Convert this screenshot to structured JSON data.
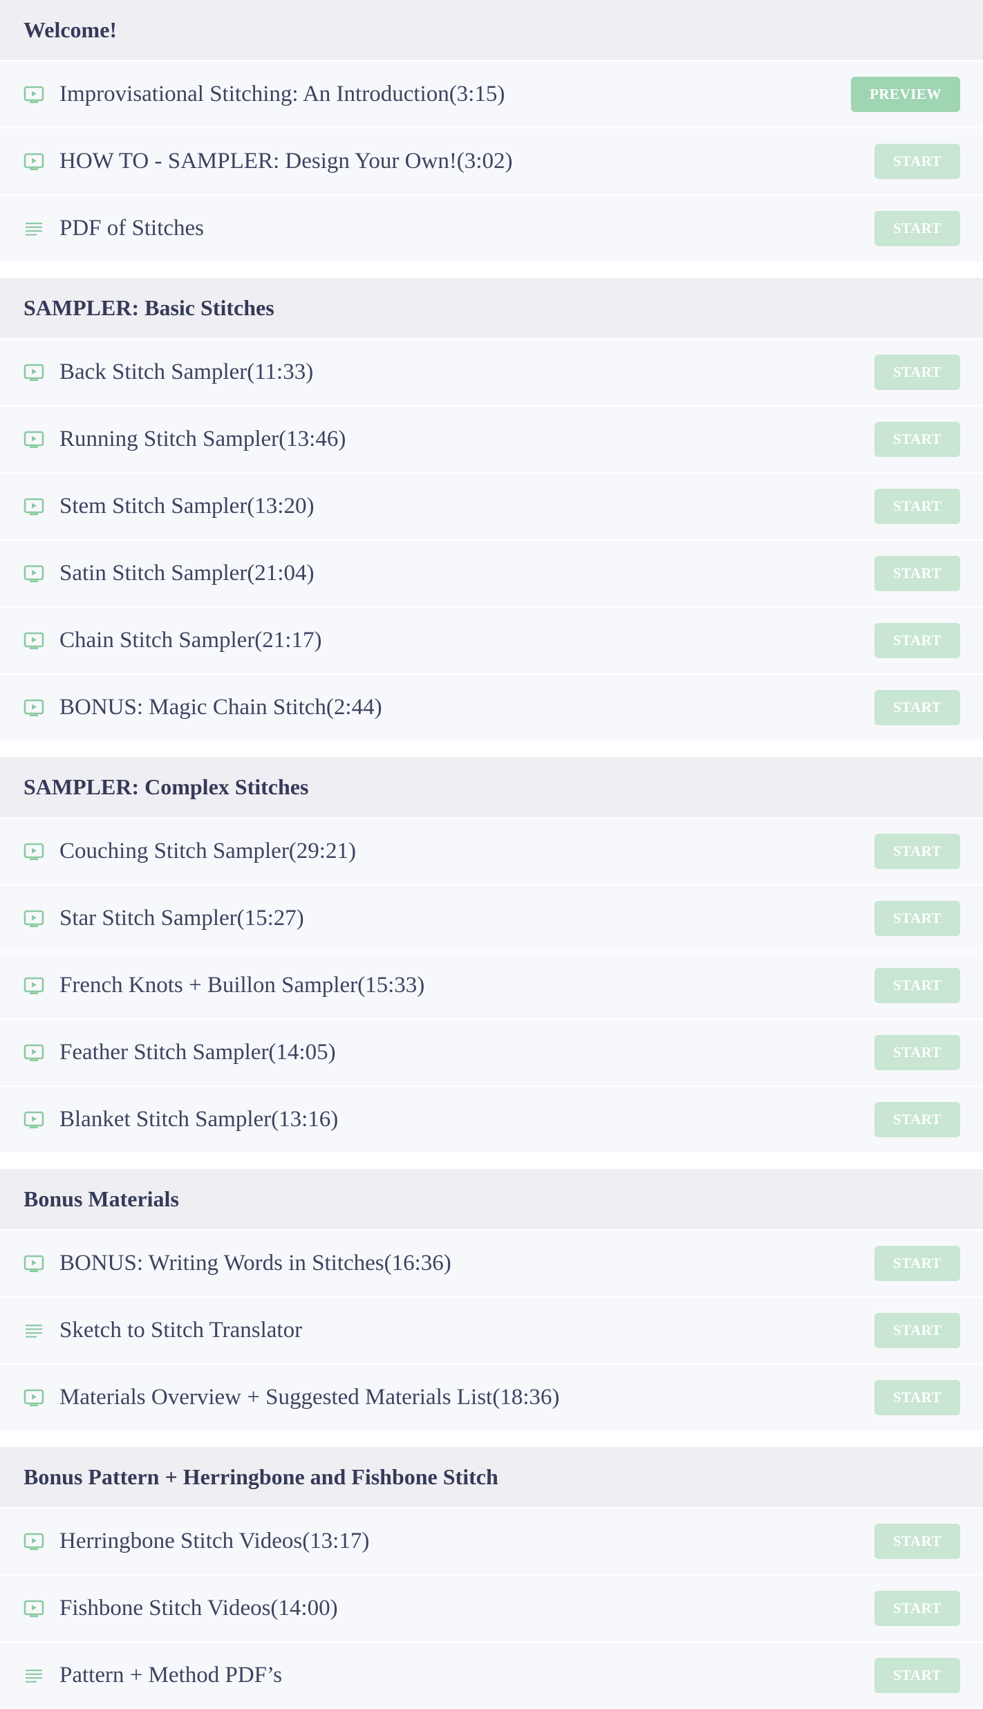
{
  "colors": {
    "accent": "#8ccaa1",
    "start_button": "#c8e6d2",
    "preview_button": "#9fd5b2",
    "section_bg": "#efeff3",
    "row_bg": "#f7f8fc",
    "heading_text": "#363a59",
    "body_text": "#3f425e"
  },
  "sections": [
    {
      "title": "Welcome!",
      "lectures": [
        {
          "icon": "video-icon",
          "title": "Improvisational Stitching: An Introduction(3:15)",
          "action": "PREVIEW"
        },
        {
          "icon": "video-icon",
          "title": "HOW TO - SAMPLER: Design Your Own!(3:02)",
          "action": "START"
        },
        {
          "icon": "text-icon",
          "title": "PDF of Stitches",
          "action": "START"
        }
      ]
    },
    {
      "title": "SAMPLER: Basic Stitches",
      "lectures": [
        {
          "icon": "video-icon",
          "title": "Back Stitch Sampler(11:33)",
          "action": "START"
        },
        {
          "icon": "video-icon",
          "title": "Running Stitch Sampler(13:46)",
          "action": "START"
        },
        {
          "icon": "video-icon",
          "title": "Stem Stitch Sampler(13:20)",
          "action": "START"
        },
        {
          "icon": "video-icon",
          "title": "Satin Stitch Sampler(21:04)",
          "action": "START"
        },
        {
          "icon": "video-icon",
          "title": "Chain Stitch Sampler(21:17)",
          "action": "START"
        },
        {
          "icon": "video-icon",
          "title": "BONUS: Magic Chain Stitch(2:44)",
          "action": "START"
        }
      ]
    },
    {
      "title": "SAMPLER: Complex Stitches",
      "lectures": [
        {
          "icon": "video-icon",
          "title": "Couching Stitch Sampler(29:21)",
          "action": "START"
        },
        {
          "icon": "video-icon",
          "title": "Star Stitch Sampler(15:27)",
          "action": "START"
        },
        {
          "icon": "video-icon",
          "title": "French Knots + Buillon Sampler(15:33)",
          "action": "START"
        },
        {
          "icon": "video-icon",
          "title": "Feather Stitch Sampler(14:05)",
          "action": "START"
        },
        {
          "icon": "video-icon",
          "title": "Blanket Stitch Sampler(13:16)",
          "action": "START"
        }
      ]
    },
    {
      "title": "Bonus Materials",
      "lectures": [
        {
          "icon": "video-icon",
          "title": "BONUS: Writing Words in Stitches(16:36)",
          "action": "START"
        },
        {
          "icon": "text-icon",
          "title": "Sketch to Stitch Translator",
          "action": "START"
        },
        {
          "icon": "video-icon",
          "title": "Materials Overview + Suggested Materials List(18:36)",
          "action": "START"
        }
      ]
    },
    {
      "title": "Bonus Pattern + Herringbone and Fishbone Stitch",
      "lectures": [
        {
          "icon": "video-icon",
          "title": "Herringbone Stitch Videos(13:17)",
          "action": "START"
        },
        {
          "icon": "video-icon",
          "title": "Fishbone Stitch Videos(14:00)",
          "action": "START"
        },
        {
          "icon": "text-icon",
          "title": "Pattern + Method PDF’s",
          "action": "START"
        }
      ]
    }
  ]
}
